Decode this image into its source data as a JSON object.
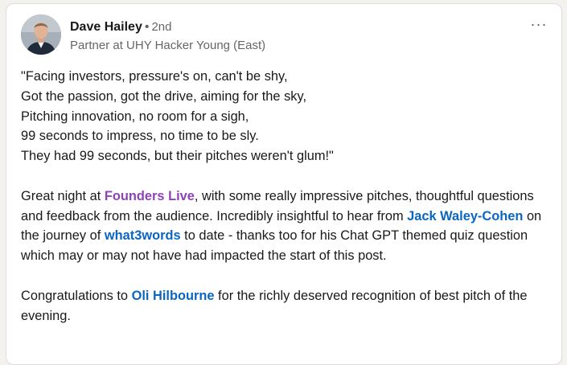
{
  "author": {
    "name": "Dave Hailey",
    "separator": "•",
    "degree": "2nd",
    "headline": "Partner at UHY Hacker Young (East)"
  },
  "menu": {
    "icon": "more-horizontal-icon",
    "label": "···"
  },
  "post": {
    "poem": [
      "\"Facing investors, pressure's on, can't be shy,",
      "Got the passion, got the drive, aiming for the sky,",
      "Pitching innovation, no room for a sigh,",
      "99 seconds to impress, no time to be sly.",
      "They had 99 seconds, but their pitches weren't glum!\""
    ],
    "para2": {
      "t1": "Great night at ",
      "mention_founders": "Founders Live",
      "t2": ", with some really impressive pitches, thoughtful questions and feedback from the audience. Incredibly insightful to hear from ",
      "mention_jack": "Jack Waley-Cohen",
      "t3": " on the journey of ",
      "mention_what3words": "what3words",
      "t4": " to date - thanks too for his Chat GPT themed quiz question which may or may not have had impacted the start of this post."
    },
    "para3": {
      "t1": "Congratulations to ",
      "mention_oli": "Oli Hilbourne",
      "t2": " for the richly deserved recognition of best pitch of the evening."
    }
  },
  "colors": {
    "mention_person": "#0a66c2",
    "mention_company": "#8c44b8",
    "text": "#191919",
    "secondary_text": "#666666"
  }
}
